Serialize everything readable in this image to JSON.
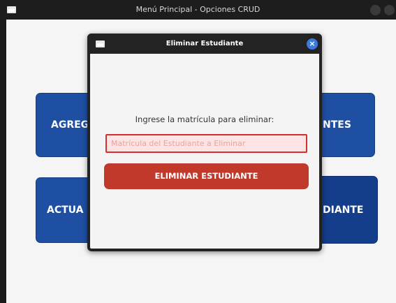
{
  "main_window": {
    "title": "Menú Principal - Opciones CRUD",
    "buttons": [
      {
        "label": "AGREG"
      },
      {
        "label": "NTES"
      },
      {
        "label": "ACTUA"
      },
      {
        "label": "DIANTE"
      }
    ]
  },
  "dialog": {
    "title": "Eliminar Estudiante",
    "close_icon": "close-icon",
    "prompt": "Ingrese la matrícula para eliminar:",
    "input_placeholder": "Matrícula del Estudiante a Eliminar",
    "input_value": "",
    "submit_label": "ELIMINAR ESTUDIANTE"
  },
  "colors": {
    "primary_blue": "#1f4fa3",
    "danger_red": "#c0392b",
    "close_blue": "#3b7be0"
  }
}
